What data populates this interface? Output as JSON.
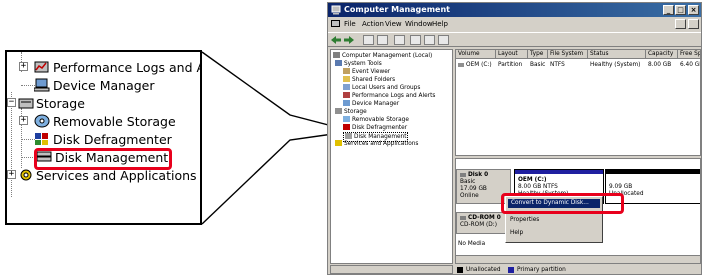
{
  "colors": {
    "highlight_red": "#e8001c",
    "title_blue": "#0a246a",
    "unallocated": "#000000",
    "primary_partition": "#1f1fa0"
  },
  "zoom": {
    "items": [
      {
        "label": "Performance Logs and Alerts",
        "icon": "performance-logs-icon"
      },
      {
        "label": "Device Manager",
        "icon": "device-manager-icon"
      },
      {
        "label": "Storage",
        "icon": "storage-icon"
      },
      {
        "label": "Removable Storage",
        "icon": "removable-storage-icon"
      },
      {
        "label": "Disk Defragmenter",
        "icon": "disk-defragmenter-icon"
      },
      {
        "label": "Disk Management",
        "icon": "disk-management-icon"
      },
      {
        "label": "Services and Applications",
        "icon": "services-icon"
      }
    ]
  },
  "window": {
    "title": "Computer Management",
    "menu": [
      "File",
      "Action",
      "View",
      "Window",
      "Help"
    ],
    "controls": {
      "min": "_",
      "max": "□",
      "close": "×"
    },
    "tree": [
      "Computer Management (Local)",
      "System Tools",
      "Event Viewer",
      "Shared Folders",
      "Local Users and Groups",
      "Performance Logs and Alerts",
      "Device Manager",
      "Storage",
      "Removable Storage",
      "Disk Defragmenter",
      "Disk Management",
      "Services and Applications"
    ],
    "volume_table": {
      "headers": [
        "Volume",
        "Layout",
        "Type",
        "File System",
        "Status",
        "Capacity",
        "Free Spa"
      ],
      "rows": [
        [
          "OEM (C:)",
          "Partition",
          "Basic",
          "NTFS",
          "Healthy (System)",
          "8.00 GB",
          "6.40 GB"
        ]
      ]
    },
    "disk0": {
      "name": "Disk 0",
      "type": "Basic",
      "size": "17.09 GB",
      "state": "Online"
    },
    "partition": {
      "name": "OEM (C:)",
      "fs": "8.00 GB NTFS",
      "status": "Healthy (System)"
    },
    "unallocated": {
      "size": "9.09 GB",
      "label": "Unallocated"
    },
    "cdrom": {
      "name": "CD-ROM 0",
      "drive": "CD-ROM (D:)",
      "media": "No Media"
    },
    "context_menu": [
      "Convert to Dynamic Disk...",
      "Properties",
      "Help"
    ],
    "legend": [
      "Unallocated",
      "Primary partition"
    ]
  }
}
